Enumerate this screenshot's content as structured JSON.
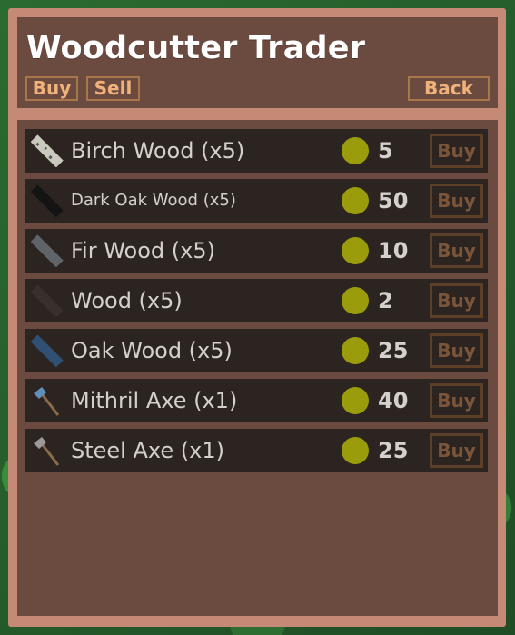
{
  "header": {
    "title": "Woodcutter Trader",
    "buy_tab": "Buy",
    "sell_tab": "Sell",
    "back_button": "Back"
  },
  "items": [
    {
      "name": "Birch Wood (x5)",
      "price": "5",
      "buy_label": "Buy",
      "icon": "birch-log-icon"
    },
    {
      "name": "Dark Oak Wood (x5)",
      "price": "50",
      "buy_label": "Buy",
      "icon": "dark-oak-log-icon"
    },
    {
      "name": "Fir Wood (x5)",
      "price": "10",
      "buy_label": "Buy",
      "icon": "fir-log-icon"
    },
    {
      "name": "Wood (x5)",
      "price": "2",
      "buy_label": "Buy",
      "icon": "wood-log-icon"
    },
    {
      "name": "Oak Wood (x5)",
      "price": "25",
      "buy_label": "Buy",
      "icon": "oak-log-icon"
    },
    {
      "name": "Mithril Axe (x1)",
      "price": "40",
      "buy_label": "Buy",
      "icon": "mithril-axe-icon"
    },
    {
      "name": "Steel Axe (x1)",
      "price": "25",
      "buy_label": "Buy",
      "icon": "steel-axe-icon"
    }
  ],
  "colors": {
    "frame": "#c58a76",
    "panel": "#6b4a3f",
    "row": "#2c2420",
    "coin": "#9a9c0c",
    "button_text": "#f0b27a"
  }
}
